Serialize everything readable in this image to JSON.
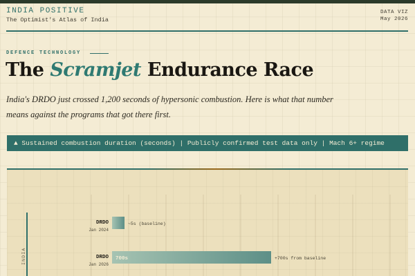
{
  "header": {
    "brand": "INDIA POSITIVE",
    "tagline": "The Optimist's Atlas of India",
    "meta_line1": "DATA VIZ",
    "meta_line2": "May 2026"
  },
  "article": {
    "kicker": "DEFENCE TECHNOLOGY",
    "headline_pre": "The ",
    "headline_accent": "Scramjet",
    "headline_post": " Endurance Race",
    "dek": "India's DRDO just crossed 1,200 seconds of hypersonic combustion. Here is what that number means against the programs that got there first."
  },
  "banner": {
    "text": "▲  Sustained combustion duration (seconds)   |   Publicly confirmed test data only   |   Mach 6+ regime"
  },
  "colors": {
    "accent": "#2f6f69",
    "bar_start": "#a6c3b2",
    "bar_end": "#5d8f87",
    "panel_bg": "#ece0bd",
    "page_bg": "#f4ecd4"
  },
  "chart_data": {
    "type": "bar",
    "orientation": "horizontal",
    "unit": "s",
    "group_label": "INDIA",
    "bars": [
      {
        "program": "DRDO",
        "date": "Jan 2024",
        "value": 5,
        "value_label": "",
        "annotation": "~5s (baseline)"
      },
      {
        "program": "DRDO",
        "date": "Jan 2026",
        "value": 700,
        "value_label": "700s",
        "annotation": "+700s from baseline"
      }
    ],
    "grid": true
  }
}
